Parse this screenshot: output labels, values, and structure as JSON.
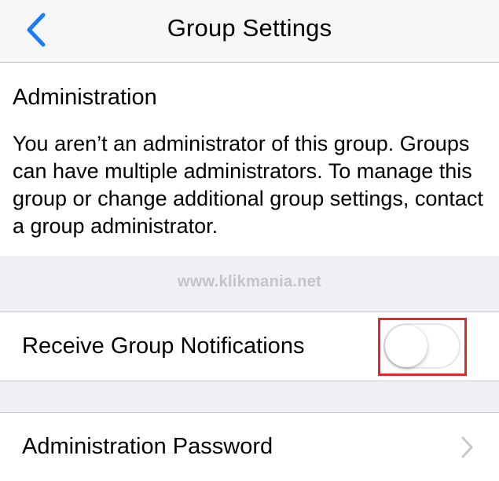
{
  "navbar": {
    "title": "Group Settings",
    "back_icon": "chevron-left-icon",
    "accent_color": "#1a7bfb"
  },
  "administration": {
    "heading": "Administration",
    "description": "You aren’t an administrator of this group. Groups can have multiple administrators. To manage this group or change additional group settings, contact a group administrator."
  },
  "watermark": "www.klikmania.net",
  "notifications": {
    "label": "Receive Group Notifications",
    "toggle_on": false,
    "highlight_color": "#e4262f"
  },
  "password": {
    "label": "Administration Password",
    "chevron_icon": "chevron-right-icon"
  }
}
